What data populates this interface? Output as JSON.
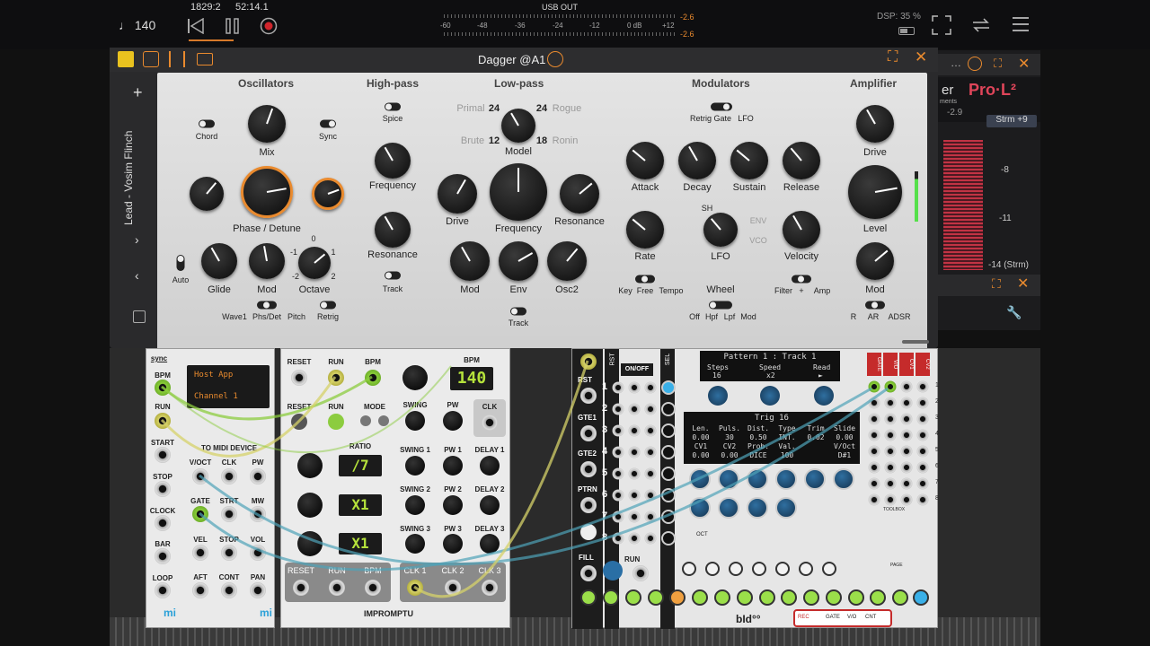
{
  "transport": {
    "tempo": "♩ 140",
    "position": "1829:2",
    "time": "52:14.1"
  },
  "meter": {
    "title": "USB OUT",
    "scale": [
      "-60",
      "-48",
      "-36",
      "-24",
      "-12",
      "0 dB",
      "+12"
    ],
    "peak_l": "-2.6",
    "peak_r": "-2.6"
  },
  "dsp": "DSP: 35 %",
  "plugin": {
    "title": "Dagger @A1",
    "preset_name": "Lead - Vosim Flinch",
    "sections": {
      "osc": "Oscillators",
      "hp": "High-pass",
      "lp": "Low-pass",
      "mods": "Modulators",
      "amp": "Amplifier"
    },
    "labels": {
      "chord": "Chord",
      "mix": "Mix",
      "sync": "Sync",
      "phase_detune": "Phase / Detune",
      "auto": "Auto",
      "glide": "Glide",
      "mod": "Mod",
      "octave": "Octave",
      "oct_0": "0",
      "oct_m1": "-1",
      "oct_1": "1",
      "oct_m2": "-2",
      "oct_2": "2",
      "wave1": "Wave1",
      "phs_det": "Phs/Det",
      "pitch": "Pitch",
      "retrig": "Retrig",
      "spice": "Spice",
      "hp_freq": "Frequency",
      "hp_res": "Resonance",
      "track": "Track",
      "primal": "Primal",
      "n24a": "24",
      "n24b": "24",
      "rogue": "Rogue",
      "brute": "Brute",
      "n12": "12",
      "n18": "18",
      "ronin": "Ronin",
      "model": "Model",
      "lp_drive": "Drive",
      "lp_freq": "Frequency",
      "lp_res": "Resonance",
      "lp_mod": "Mod",
      "lp_env": "Env",
      "lp_osc2": "Osc2",
      "lp_track": "Track",
      "retrig_gate": "Retrig Gate",
      "lfo_top": "LFO",
      "attack": "Attack",
      "decay": "Decay",
      "sustain": "Sustain",
      "release": "Release",
      "rate": "Rate",
      "lfo": "LFO",
      "sh": "SH",
      "env": "ENV",
      "vco": "VCO",
      "velocity": "Velocity",
      "key": "Key",
      "free": "Free",
      "tempo": "Tempo",
      "wheel": "Wheel",
      "off": "Off",
      "hpf": "Hpf",
      "lpf": "Lpf",
      "wmod": "Mod",
      "filter": "Filter",
      "plus": "+",
      "amp": "Amp",
      "amp_drive": "Drive",
      "level": "Level",
      "amp_mod": "Mod",
      "r": "R",
      "ar": "AR",
      "adsr": "ADSR"
    }
  },
  "side_plugin": {
    "name_fragment": "er",
    "name_sub": "ments",
    "prol": "Pro·L²",
    "db": "-2.9",
    "strm": "Strm +9",
    "m8": "-8",
    "m11": "-11",
    "m14": "-14 (Strm)"
  },
  "rack": {
    "midi": {
      "sync": "sync",
      "bpm": "BPM",
      "run": "RUN",
      "start": "START",
      "stop": "STOP",
      "clock": "CLOCK",
      "bar": "BAR",
      "loop": "LOOP",
      "host": "Host App",
      "channel": "Channel 1",
      "to_midi": "TO MIDI DEVICE",
      "voct": "V/OCT",
      "clk": "CLK",
      "pw": "PW",
      "gate": "GATE",
      "strt": "STRT",
      "mw": "MW",
      "vel": "VEL",
      "stop2": "STOP",
      "vol": "VOL",
      "aft": "AFT",
      "cont": "CONT",
      "pan": "PAN",
      "mi": "mi"
    },
    "clocked": {
      "reset": "RESET",
      "run": "RUN",
      "bpm": "BPM",
      "bpm_value": "140",
      "clk": "CLK",
      "mode": "MODE",
      "swing": "SWING",
      "pw": "PW",
      "ratio": "RATIO",
      "ratio1": "/7",
      "ratio2": "X1",
      "ratio3": "X1",
      "swing1": "SWING 1",
      "pw1": "PW 1",
      "delay1": "DELAY 1",
      "swing2": "SWING 2",
      "pw2": "PW 2",
      "delay2": "DELAY 2",
      "swing3": "SWING 3",
      "pw3": "PW 3",
      "delay3": "DELAY 3",
      "clk1": "CLK 1",
      "clk2": "CLK 2",
      "clk3": "CLK 3",
      "brand": "IMPROMPTU"
    },
    "seq": {
      "rst": "RST",
      "sel": "SEL",
      "onoff": "ON/OFF",
      "gte1": "GTE1",
      "gte2": "GTE2",
      "ptrn": "PTRN",
      "fill": "FILL",
      "run": "RUN",
      "pattern_title": "Pattern 1 : Track 1",
      "steps_label": "Steps",
      "steps_val": "16",
      "speed_label": "Speed",
      "speed_val": "x2",
      "read_label": "Read",
      "read_val": "►",
      "trig_title": "Trig 16",
      "row1": [
        "Len.",
        "Puls.",
        "Dist.",
        "Type",
        "Trim",
        "Slide"
      ],
      "row2": [
        "0.00",
        "30",
        "0.50",
        "INT.",
        "0.02",
        "0.00"
      ],
      "row3": [
        "CV1",
        "CV2",
        "Prob.",
        "Val.",
        "",
        "V/Oct"
      ],
      "row4": [
        "0.00",
        "0.00",
        "DICE",
        "100",
        "",
        "D#1"
      ],
      "gate": "GATE",
      "vo": "V/O",
      "cv1": "CV1",
      "cv2": "CV2",
      "toolbox": "TOOLBOX",
      "page": "PAGE",
      "oct": "OCT",
      "nums": [
        "1",
        "2",
        "3",
        "4",
        "5",
        "6",
        "7",
        "8"
      ],
      "brand": "bId°°",
      "rec": "REC",
      "gate2": "GATE",
      "vo2": "V/O",
      "cnt": "CNT"
    }
  }
}
